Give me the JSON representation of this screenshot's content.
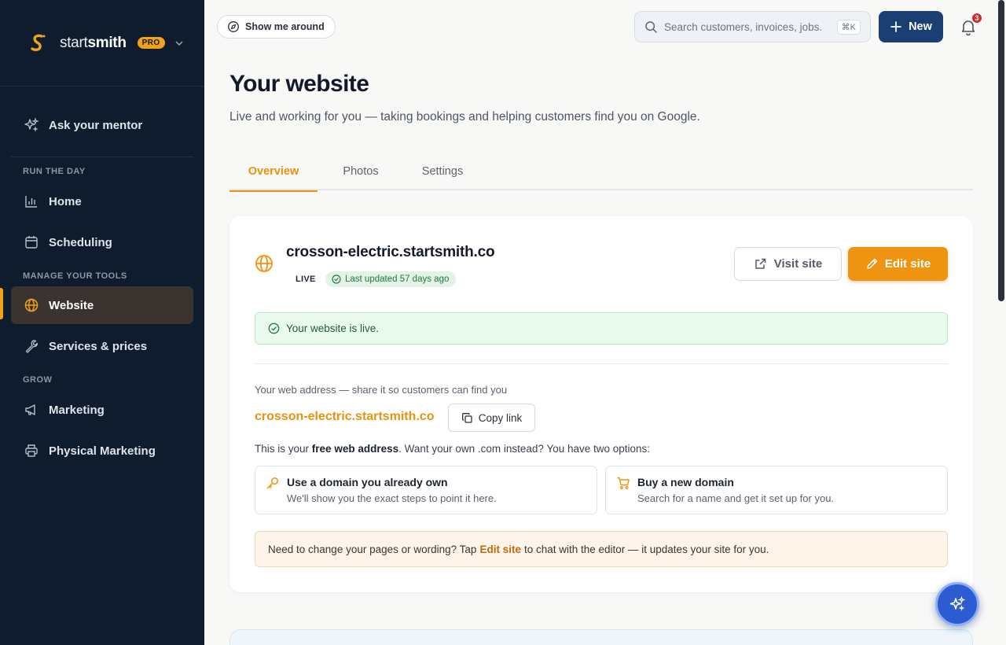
{
  "sidebar": {
    "brand": {
      "light": "start",
      "bold": "smith",
      "badge": "PRO"
    },
    "items": {
      "mentor": "Ask your mentor",
      "home": "Home",
      "scheduling": "Scheduling",
      "website": "Website",
      "services": "Services & prices",
      "marketing": "Marketing",
      "physical": "Physical Marketing"
    },
    "sections": {
      "run": "RUN THE DAY",
      "manage": "MANAGE YOUR TOOLS",
      "grow": "GROW"
    }
  },
  "topbar": {
    "tour_label": "Show me around",
    "search_placeholder": "Search customers, invoices, jobs...",
    "search_shortcut": "⌘K",
    "new_label": "New",
    "notification_count": "3"
  },
  "page": {
    "title": "Your website",
    "subtitle": "Live and working for you — taking bookings and helping customers find you on Google."
  },
  "tabs": [
    "Overview",
    "Photos",
    "Settings"
  ],
  "site": {
    "domain": "crosson-electric.startsmith.co",
    "status": "LIVE",
    "updated": "Last updated 57 days ago",
    "visit_label": "Visit site",
    "edit_label": "Edit site",
    "live_message": "Your website is live.",
    "address_label": "Your web address — share it so customers can find you",
    "address": "crosson-electric.startsmith.co",
    "copy_label": "Copy link",
    "free_prefix": "This is your",
    "free_bold": "free web address",
    "free_suffix": ". Want your own .com instead? You have two options:",
    "options": [
      {
        "title": "Use a domain you already own",
        "desc": "We'll show you the exact steps to point it here."
      },
      {
        "title": "Buy a new domain",
        "desc": "Search for a name and get it set up for you."
      }
    ],
    "note_prefix": "Need to change your pages or wording? Tap",
    "note_bold": "Edit site",
    "note_suffix": "to chat with the editor — it updates your site for you."
  },
  "colors": {
    "sidebar_bg": "#0f1c2e",
    "accent": "#ef9410",
    "primary": "#1b3f72",
    "success": "#1f7a3d"
  },
  "icons": {
    "brand": "startsmith-logo-icon",
    "mentor": "sparkles-icon",
    "home": "bar-chart-icon",
    "scheduling": "calendar-icon",
    "website": "globe-icon",
    "services": "wrench-icon",
    "marketing": "megaphone-icon",
    "physical": "printer-icon",
    "tour": "compass-icon",
    "search": "search-icon",
    "new": "plus-icon",
    "bell": "bell-icon",
    "visit": "external-link-icon",
    "edit": "pencil-icon",
    "check": "check-circle-icon",
    "copy": "copy-icon",
    "key": "key-icon",
    "cart": "cart-icon",
    "fab": "sparkles-icon"
  }
}
